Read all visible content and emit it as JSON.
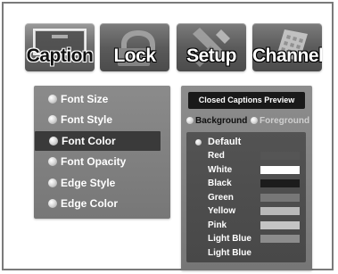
{
  "tabs": [
    {
      "label": "Caption",
      "icon": "caption-icon",
      "active": true
    },
    {
      "label": "Lock",
      "icon": "lock-icon",
      "active": false
    },
    {
      "label": "Setup",
      "icon": "tools-icon",
      "active": false
    },
    {
      "label": "Channel",
      "icon": "keypad-icon",
      "active": false
    }
  ],
  "menu": {
    "items": [
      {
        "label": "Font Size",
        "selected": false
      },
      {
        "label": "Font Style",
        "selected": false
      },
      {
        "label": "Font Color",
        "selected": true
      },
      {
        "label": "Font Opacity",
        "selected": false
      },
      {
        "label": "Edge Style",
        "selected": false
      },
      {
        "label": "Edge Color",
        "selected": false
      }
    ]
  },
  "preview": {
    "title": "Closed Captions Preview",
    "background_option": "Background",
    "foreground_option": "Foreground",
    "default_label": "Default",
    "colors": [
      {
        "label": "Red",
        "swatch_color": "#555555"
      },
      {
        "label": "White",
        "swatch_color": "#ffffff"
      },
      {
        "label": "Black",
        "swatch_color": "#1c1c1c"
      },
      {
        "label": "Green",
        "swatch_color": "#777777"
      },
      {
        "label": "Yellow",
        "swatch_color": "#b9b9b9"
      },
      {
        "label": "Pink",
        "swatch_color": "#c4c4c4"
      },
      {
        "label": "Light Blue",
        "swatch_color": "#8c8c8c"
      },
      {
        "label": "Light Blue",
        "swatch_color": ""
      }
    ]
  },
  "theme": {
    "panel_gray": "#7d7d7d",
    "selected_row": "#3a3a3a",
    "dark_panel": "#4f4f4f",
    "title_bar": "#191919"
  }
}
